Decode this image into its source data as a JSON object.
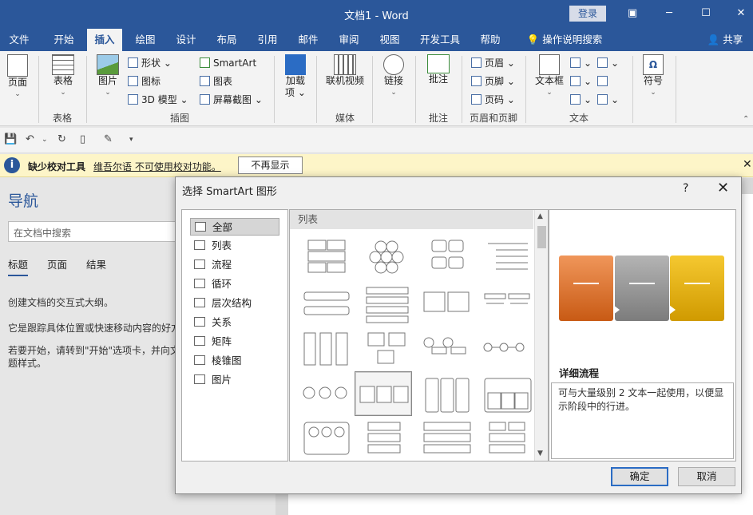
{
  "window": {
    "title": "文档1 - Word",
    "login": "登录"
  },
  "tabs": [
    "文件",
    "开始",
    "插入",
    "绘图",
    "设计",
    "布局",
    "引用",
    "邮件",
    "审阅",
    "视图",
    "开发工具",
    "帮助"
  ],
  "tell_me": "操作说明搜索",
  "share": "共享",
  "ribbon": {
    "page": "页面",
    "table": "表格",
    "table_group": "表格",
    "picture": "图片",
    "shapes": "形状",
    "icons": "图标",
    "model3d": "3D 模型",
    "smartart": "SmartArt",
    "chart": "图表",
    "screenshot": "屏幕截图",
    "illustrations_group": "插图",
    "addins_line1": "加载",
    "addins_line2": "项",
    "online_video": "联机视频",
    "media_group": "媒体",
    "link": "链接",
    "comment": "批注",
    "comment_group": "批注",
    "header": "页眉",
    "footer": "页脚",
    "page_number": "页码",
    "hf_group": "页眉和页脚",
    "textbox": "文本框",
    "text_group": "文本",
    "symbol": "符号"
  },
  "message_bar": {
    "title": "缺少校对工具",
    "link": "维吾尔语 不可使用校对功能。",
    "button": "不再显示"
  },
  "nav": {
    "title": "导航",
    "search_placeholder": "在文档中搜索",
    "tabs": [
      "标题",
      "页面",
      "结果"
    ],
    "p1": "创建文档的交互式大纲。",
    "p2": "它是跟踪具体位置或快速移动内容的好方",
    "p3": "若要开始，请转到\"开始\"选项卡，并向文",
    "p4": "题样式。"
  },
  "dialog": {
    "title": "选择 SmartArt 图形",
    "help": "?",
    "categories": [
      "全部",
      "列表",
      "流程",
      "循环",
      "层次结构",
      "关系",
      "矩阵",
      "棱锥图",
      "图片"
    ],
    "gallery_header": "列表",
    "selected_name": "详细流程",
    "selected_desc": "可与大量级别 2 文本一起使用，以便显示阶段中的行进。",
    "ok": "确定",
    "cancel": "取消"
  },
  "colors": {
    "brand": "#2b579a",
    "orange": "#d86e28",
    "gray": "#8c8c8c",
    "gold": "#e0a800"
  }
}
